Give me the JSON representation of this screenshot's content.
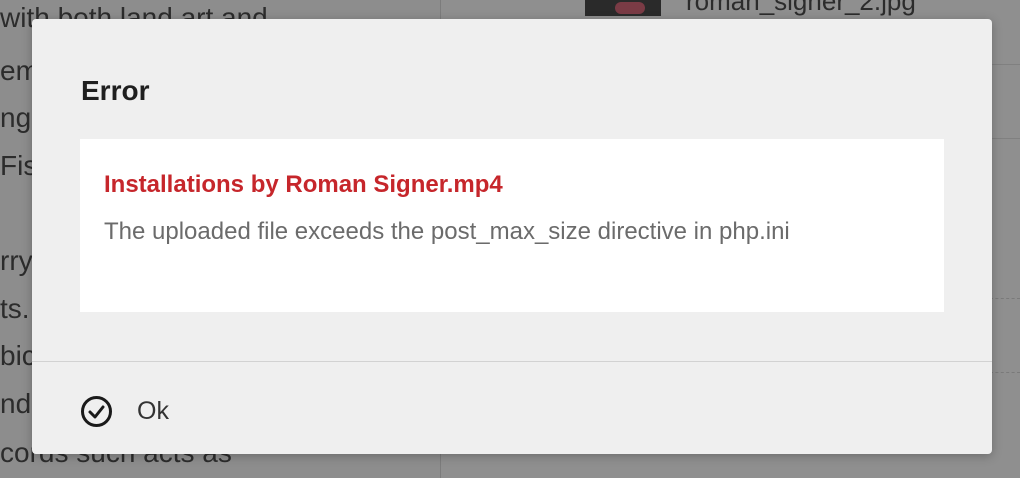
{
  "background": {
    "left_text_lines": [
      " with both land art and",
      "em",
      "ng",
      "Fis",
      "",
      "rry",
      "ts.",
      "bic",
      "nd",
      "cords such acts as"
    ],
    "right_filename": "roman_signer_2.jpg"
  },
  "modal": {
    "title": "Error",
    "error": {
      "filename": "Installations by Roman Signer.mp4",
      "message": "The uploaded file exceeds the post_max_size directive in php.ini"
    },
    "ok_label": "Ok"
  },
  "colors": {
    "error_red": "#c6262b",
    "modal_bg": "#efefef",
    "overlay": "#8d8d8d"
  }
}
